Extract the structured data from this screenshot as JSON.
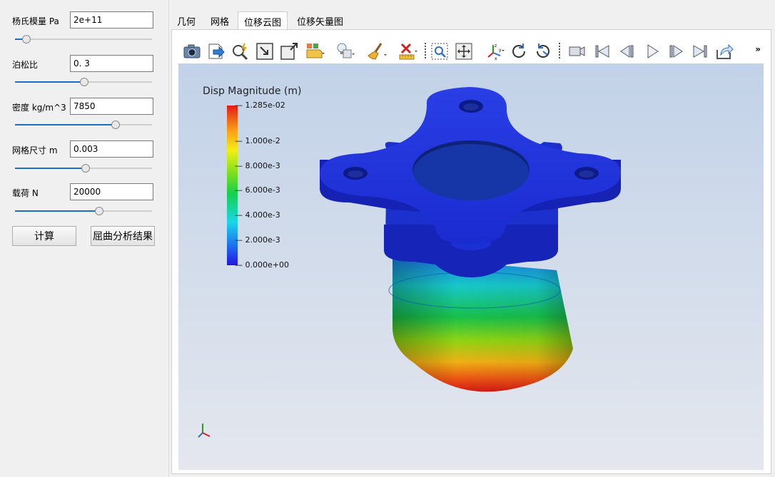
{
  "params": [
    {
      "label": "杨氏模量 Pa",
      "value": "2e+11",
      "slider_fraction": 0.08
    },
    {
      "label": "泊松比",
      "value": "0. 3",
      "slider_fraction": 0.5
    },
    {
      "label": "密度 kg/m^3",
      "value": "7850",
      "slider_fraction": 0.73
    },
    {
      "label": "网格尺寸 m",
      "value": "0.003",
      "slider_fraction": 0.51
    },
    {
      "label": "载荷 N",
      "value": "20000",
      "slider_fraction": 0.61
    }
  ],
  "buttons": {
    "compute": "计算",
    "buckling": "屈曲分析结果"
  },
  "tabs": [
    {
      "label": "几何",
      "active": false
    },
    {
      "label": "网格",
      "active": false
    },
    {
      "label": "位移云图",
      "active": true
    },
    {
      "label": "位移矢量图",
      "active": false
    }
  ],
  "toolbar_icons": [
    "camera-icon",
    "export-icon",
    "zoom-magic-icon",
    "fit-view-icon",
    "maximize-icon",
    "open-folder-icon",
    "lightbulb-icon",
    "clear-brush-icon",
    "measure-ruler-icon",
    "zoom-box-icon",
    "pan-icon",
    "axes-icon",
    "rotate-cw-icon",
    "rotate-ccw-icon",
    "record-icon",
    "first-frame-icon",
    "prev-frame-icon",
    "play-icon",
    "next-frame-icon",
    "last-frame-icon",
    "share-icon"
  ],
  "toolbar_more": "»",
  "legend": {
    "title": "Disp Magnitude (m)",
    "ticks": [
      "1.285e-02",
      "1.000e-2",
      "8.000e-3",
      "6.000e-3",
      "4.000e-3",
      "2.000e-3",
      "0.000e+00"
    ],
    "tick_values": [
      0.01285,
      0.01,
      0.008,
      0.006,
      0.004,
      0.002,
      0.0
    ]
  },
  "colors": {
    "accent": "#1a6fc4",
    "low": "#1a18d8",
    "high": "#e21a14"
  }
}
